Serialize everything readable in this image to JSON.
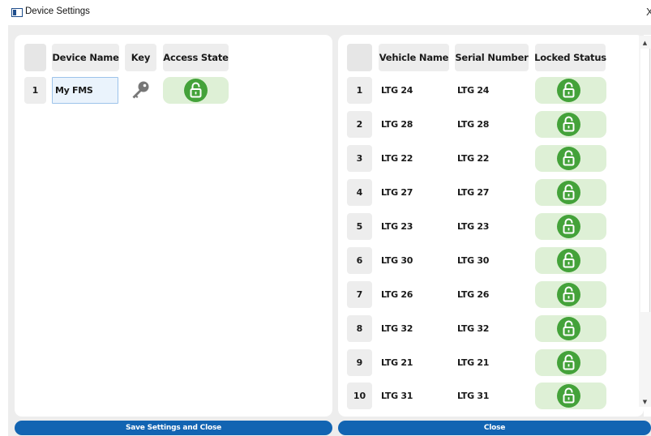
{
  "window": {
    "title": "Device Settings",
    "close_glyph": "X"
  },
  "left_table": {
    "headers": {
      "device_name": "Device Name",
      "key": "Key",
      "access_state": "Access State"
    },
    "rows": [
      {
        "num": "1",
        "device_name": "My FMS",
        "key_icon": "key-icon",
        "access_state": "unlocked"
      }
    ]
  },
  "right_table": {
    "headers": {
      "vehicle_name": "Vehicle Name",
      "serial_number": "Serial Number",
      "locked_status": "Locked Status"
    },
    "rows": [
      {
        "num": "1",
        "vehicle_name": "LTG 24",
        "serial_number": "LTG 24",
        "locked_status": "unlocked"
      },
      {
        "num": "2",
        "vehicle_name": "LTG 28",
        "serial_number": "LTG 28",
        "locked_status": "unlocked"
      },
      {
        "num": "3",
        "vehicle_name": "LTG 22",
        "serial_number": "LTG 22",
        "locked_status": "unlocked"
      },
      {
        "num": "4",
        "vehicle_name": "LTG 27",
        "serial_number": "LTG 27",
        "locked_status": "unlocked"
      },
      {
        "num": "5",
        "vehicle_name": "LTG 23",
        "serial_number": "LTG 23",
        "locked_status": "unlocked"
      },
      {
        "num": "6",
        "vehicle_name": "LTG 30",
        "serial_number": "LTG 30",
        "locked_status": "unlocked"
      },
      {
        "num": "7",
        "vehicle_name": "LTG 26",
        "serial_number": "LTG 26",
        "locked_status": "unlocked"
      },
      {
        "num": "8",
        "vehicle_name": "LTG 32",
        "serial_number": "LTG 32",
        "locked_status": "unlocked"
      },
      {
        "num": "9",
        "vehicle_name": "LTG 21",
        "serial_number": "LTG 21",
        "locked_status": "unlocked"
      },
      {
        "num": "10",
        "vehicle_name": "LTG 31",
        "serial_number": "LTG 31",
        "locked_status": "unlocked"
      }
    ]
  },
  "buttons": {
    "save_label": "Save Settings and Close",
    "close_label": "Close"
  },
  "icons": {
    "window": "app-window-icon",
    "lock": "unlocked-padlock-icon",
    "key": "key-icon",
    "scroll_up": "scroll-up-arrow-icon",
    "scroll_down": "scroll-down-arrow-icon"
  },
  "colors": {
    "lock_green": "#44a23a",
    "lock_cell_bg": "#def0d6",
    "button_blue": "#1264b2",
    "input_border": "#9dc3ea",
    "input_bg": "#eaf3fc",
    "header_cell_bg": "#ededed"
  }
}
